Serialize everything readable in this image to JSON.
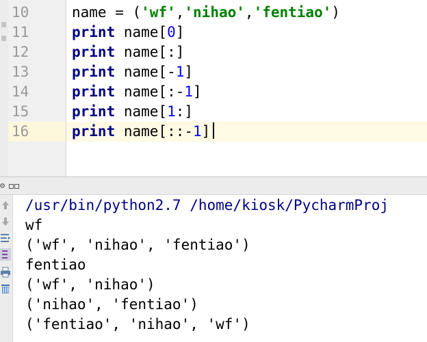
{
  "editor": {
    "current_line": "16",
    "lines": [
      {
        "number": "10",
        "segments": [
          {
            "t": "name = (",
            "c": ""
          },
          {
            "t": "'wf'",
            "c": "str"
          },
          {
            "t": ",",
            "c": ""
          },
          {
            "t": "'nihao'",
            "c": "str"
          },
          {
            "t": ",",
            "c": ""
          },
          {
            "t": "'fentiao'",
            "c": "str"
          },
          {
            "t": ")",
            "c": ""
          }
        ]
      },
      {
        "number": "11",
        "segments": [
          {
            "t": "print",
            "c": "kw"
          },
          {
            "t": " name[",
            "c": ""
          },
          {
            "t": "0",
            "c": "num"
          },
          {
            "t": "]",
            "c": ""
          }
        ]
      },
      {
        "number": "12",
        "segments": [
          {
            "t": "print",
            "c": "kw"
          },
          {
            "t": " name[:]",
            "c": ""
          }
        ]
      },
      {
        "number": "13",
        "segments": [
          {
            "t": "print",
            "c": "kw"
          },
          {
            "t": " name[-",
            "c": ""
          },
          {
            "t": "1",
            "c": "num"
          },
          {
            "t": "]",
            "c": ""
          }
        ]
      },
      {
        "number": "14",
        "segments": [
          {
            "t": "print",
            "c": "kw"
          },
          {
            "t": " name[:-",
            "c": ""
          },
          {
            "t": "1",
            "c": "num"
          },
          {
            "t": "]",
            "c": ""
          }
        ]
      },
      {
        "number": "15",
        "segments": [
          {
            "t": "print",
            "c": "kw"
          },
          {
            "t": " name[",
            "c": ""
          },
          {
            "t": "1",
            "c": "num"
          },
          {
            "t": ":]",
            "c": ""
          }
        ]
      },
      {
        "number": "16",
        "segments": [
          {
            "t": "print",
            "c": "kw"
          },
          {
            "t": " name[::-",
            "c": ""
          },
          {
            "t": "1",
            "c": "num"
          },
          {
            "t": "]",
            "c": ""
          }
        ]
      }
    ]
  },
  "colors": {
    "keyword": "#000080",
    "string": "#008000",
    "number": "#0000ff",
    "command": "#000080",
    "current_line_bg": "#fffae3"
  },
  "run_panel": {
    "header_icons": [
      "gear-icon",
      "restore-tab-icon",
      "minimize-tab-icon"
    ],
    "toolbar_icons": [
      "scroll-up-arrow-icon",
      "scroll-down-arrow-icon",
      "soft-wrap-icon",
      "scroll-to-end-icon",
      "print-icon",
      "clear-trash-icon"
    ],
    "console": {
      "command": "/usr/bin/python2.7 /home/kiosk/PycharmProj",
      "output": [
        "wf",
        "('wf', 'nihao', 'fentiao')",
        "fentiao",
        "('wf', 'nihao')",
        "('nihao', 'fentiao')",
        "('fentiao', 'nihao', 'wf')"
      ]
    }
  }
}
